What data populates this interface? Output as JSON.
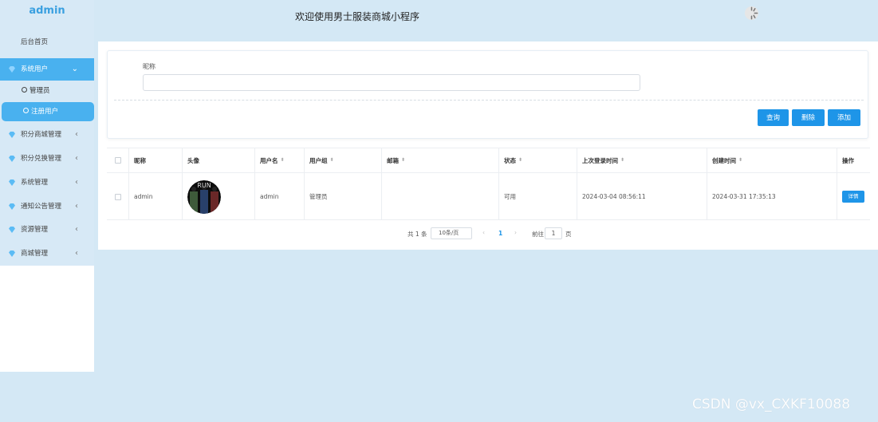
{
  "app": {
    "logo": "admin",
    "header_title": "欢迎使用男士服装商城小程序"
  },
  "sidebar": {
    "home": "后台首页",
    "menus": [
      {
        "label": "系统用户",
        "active": true,
        "arrow": "⌄"
      },
      {
        "label": "积分商城管理",
        "arrow": "‹"
      },
      {
        "label": "积分兑换管理",
        "arrow": "‹"
      },
      {
        "label": "系统管理",
        "arrow": "‹"
      },
      {
        "label": "通知公告管理",
        "arrow": "‹"
      },
      {
        "label": "资源管理",
        "arrow": "‹"
      },
      {
        "label": "商城管理",
        "arrow": "‹"
      }
    ],
    "sub_items": [
      {
        "label": "管理员"
      },
      {
        "label": "注册用户",
        "active": true
      }
    ]
  },
  "search": {
    "label": "昵称",
    "value": "",
    "buttons": {
      "query": "查询",
      "delete": "删除",
      "add": "添加"
    }
  },
  "table": {
    "headers": [
      "",
      "昵称",
      "头像",
      "用户名",
      "用户组",
      "邮箱",
      "状态",
      "上次登录时间",
      "创建时间",
      "操作"
    ],
    "rows": [
      {
        "nickname": "admin",
        "username": "admin",
        "group": "管理员",
        "email": "",
        "status": "可用",
        "last_login": "2024-03-04 08:56:11",
        "created": "2024-03-31 17:35:13",
        "action": "详情"
      }
    ]
  },
  "pager": {
    "total": "共 1 条",
    "page_size": "10条/页",
    "current": "1",
    "goto_label": "前往",
    "goto_value": "1",
    "page_word": "页",
    "prev": "‹",
    "next": "›"
  },
  "colors": {
    "accent": "#1e95e8",
    "menu_active": "#49b1ef",
    "background": "#d4e8f5"
  },
  "watermark": "CSDN @vx_CXKF10088"
}
